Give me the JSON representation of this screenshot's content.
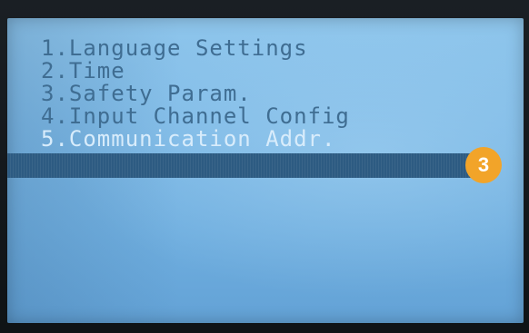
{
  "menu": {
    "items": [
      {
        "label": "1.Language Settings"
      },
      {
        "label": "2.Time"
      },
      {
        "label": "3.Safety Param."
      },
      {
        "label": "4.Input Channel Config"
      },
      {
        "label": "5.Communication Addr."
      }
    ],
    "selected_index": 4
  },
  "annotation": {
    "badge_text": "3"
  },
  "colors": {
    "screen_background": "#7db9e6",
    "text": "#3f6d92",
    "highlight_bar": "#2d5b82",
    "highlight_text": "#d8ecfb",
    "badge": "#f2a429"
  }
}
